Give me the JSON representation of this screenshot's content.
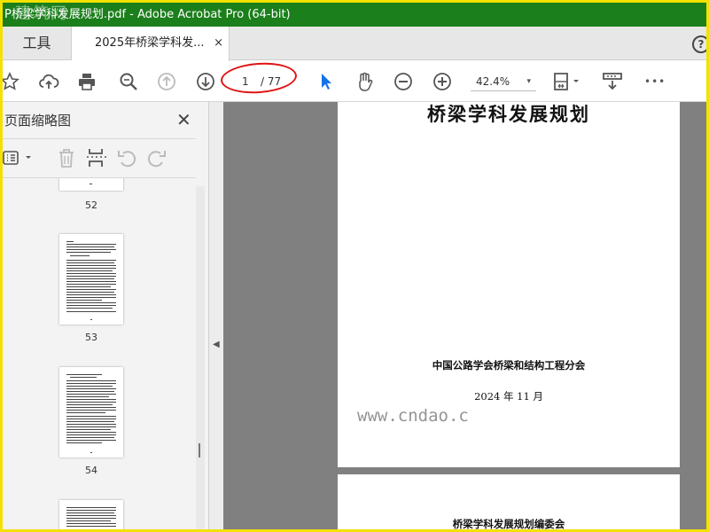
{
  "window": {
    "title": "P桥梁学科发展规划.pdf - Adobe Acrobat Pro (64-bit)",
    "watermark": "建筑网"
  },
  "tabs": {
    "tools_label": "工具",
    "doc_label": "2025年桥梁学科发...",
    "close_glyph": "×",
    "help_glyph": "?"
  },
  "toolbar": {
    "icons": [
      "star-icon",
      "cloud-upload-icon",
      "print-icon",
      "zoom-search-icon",
      "page-up-icon",
      "page-down-icon",
      "select-arrow-icon",
      "hand-icon",
      "zoom-out-icon",
      "zoom-in-icon",
      "fit-page-icon",
      "scan-icon",
      "more-icon"
    ],
    "current_page": "1",
    "total_pages": "/ 77",
    "zoom": "42.4%",
    "zoom_caret": "▾",
    "more_glyph": "•••"
  },
  "panel": {
    "title": "页面缩略图",
    "close_glyph": "✕",
    "thumbnails": [
      {
        "page": "52"
      },
      {
        "page": "53"
      },
      {
        "page": "54"
      },
      {
        "page": ""
      }
    ]
  },
  "document": {
    "title": "桥梁学科发展规划",
    "organization": "中国公路学会桥梁和结构工程分会",
    "date": "2024 年 11 月",
    "page2_text": "桥梁学科发展规划编委会"
  },
  "overlay": {
    "watermark": "www.cndao.c"
  },
  "colors": {
    "title_bar": "#1b7f1b",
    "frame": "#f3e100",
    "highlight_oval": "#e01515",
    "select_tool": "#1473e6"
  }
}
